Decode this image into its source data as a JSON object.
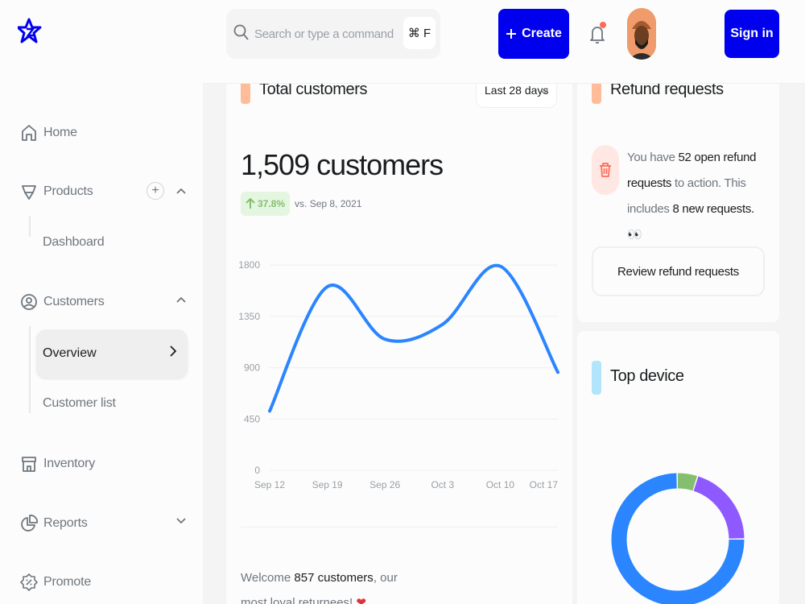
{
  "sidebar": {
    "items": [
      {
        "label": "Home",
        "icon": "home-icon"
      },
      {
        "label": "Products",
        "icon": "diamond-icon"
      },
      {
        "label": "Dashboard"
      },
      {
        "label": "Customers",
        "icon": "user-circle-icon"
      },
      {
        "label": "Overview"
      },
      {
        "label": "Customer list"
      },
      {
        "label": "Inventory",
        "icon": "store-icon"
      },
      {
        "label": "Reports",
        "icon": "pie-chart-icon"
      },
      {
        "label": "Promote",
        "icon": "promotion-icon"
      }
    ],
    "add_symbol": "+"
  },
  "header": {
    "search_placeholder": "Search or type a command",
    "shortcut": "⌘ F",
    "create_label": "Create",
    "signin_label": "Sign in"
  },
  "customers_card": {
    "title": "Total customers",
    "period": "Last 28 days",
    "total": "1,509 customers",
    "trend_value": "37.8%",
    "trend_vs": "vs. Sep 8, 2021",
    "welcome_prefix": "Welcome ",
    "welcome_bold": "857 customers",
    "welcome_suffix": ", our most loyal returnees! ",
    "welcome_emoji": "❤"
  },
  "refund_card": {
    "title": "Refund requests",
    "text_1": "You have ",
    "text_2": "52 open refund requests",
    "text_3": " to action. This includes ",
    "text_4": "8 new requests.",
    "text_emoji": "👀",
    "button_label": "Review refund requests"
  },
  "device_card": {
    "title": "Top device"
  },
  "colors": {
    "accent": "#0000ee",
    "line": "#2a85ff",
    "tag_orange": "#ffbc99",
    "tag_blue": "#b1e5fc",
    "donut_blue": "#2a85ff",
    "donut_green": "#83bf6e",
    "donut_purple": "#8e59ff"
  },
  "chart_data": {
    "type": "line",
    "x": [
      "Sep 12",
      "Sep 19",
      "Sep 26",
      "Oct 3",
      "Oct 10",
      "Oct 17"
    ],
    "x_days": [
      0,
      7,
      14,
      21,
      28,
      35
    ],
    "series": [
      {
        "values_days": [
          0,
          7,
          14,
          21,
          28,
          35
        ],
        "y": [
          520,
          1610,
          1150,
          1280,
          1790,
          860
        ]
      }
    ],
    "yticks": [
      0,
      450,
      900,
      1350,
      1800
    ],
    "ylim": [
      0,
      1900
    ],
    "grid": true
  },
  "donut_data": {
    "type": "pie",
    "segments": [
      {
        "value": 5,
        "color": "#83bf6e"
      },
      {
        "value": 20,
        "color": "#8e59ff"
      },
      {
        "value": 75,
        "color": "#2a85ff"
      }
    ]
  }
}
